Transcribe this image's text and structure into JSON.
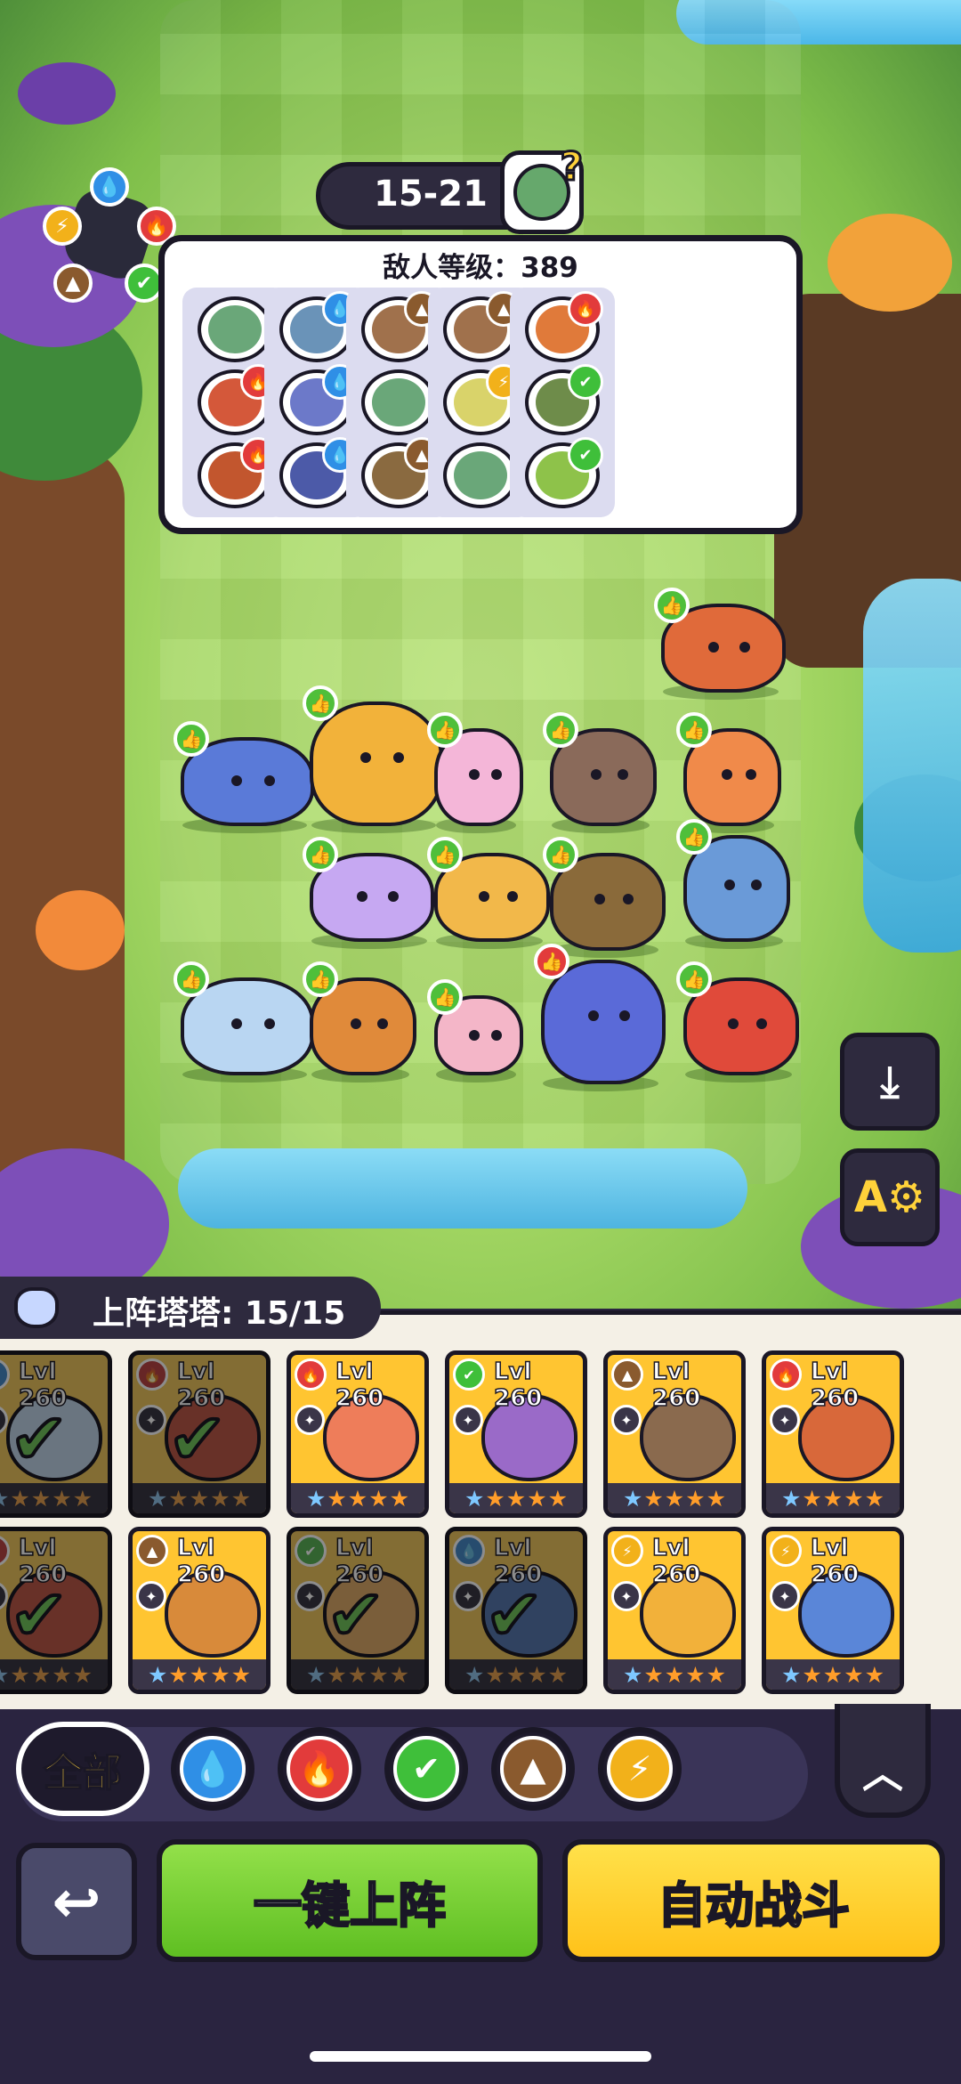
{
  "stage": {
    "label": "15-21"
  },
  "enemy_panel": {
    "title": "敌人等级：389",
    "waves": [
      {
        "enemies": [
          {
            "face": "#6aa779",
            "element": "none"
          },
          {
            "face": "#d4583a",
            "element": "fire"
          },
          {
            "face": "#c2562e",
            "element": "fire"
          }
        ]
      },
      {
        "enemies": [
          {
            "face": "#6a93b8",
            "element": "water"
          },
          {
            "face": "#6c79c9",
            "element": "water"
          },
          {
            "face": "#4c5aa8",
            "element": "water"
          }
        ]
      },
      {
        "enemies": [
          {
            "face": "#a0714c",
            "element": "earth"
          },
          {
            "face": "#6aa779",
            "element": "none"
          },
          {
            "face": "#8a6a40",
            "element": "earth"
          }
        ]
      },
      {
        "enemies": [
          {
            "face": "#a0714c",
            "element": "earth"
          },
          {
            "face": "#d9d36a",
            "element": "lightning"
          },
          {
            "face": "#6aa779",
            "element": "none"
          }
        ]
      },
      {
        "enemies": [
          {
            "face": "#e07a3a",
            "element": "fire"
          },
          {
            "face": "#6e8c4a",
            "element": "nature"
          },
          {
            "face": "#8ec24a",
            "element": "nature"
          }
        ]
      }
    ]
  },
  "roster": {
    "label": "上阵塔塔: 15/15",
    "cards": [
      {
        "level": "Lvl 260",
        "element": "water",
        "art": "#b9d6f2",
        "deployed": true,
        "cut": true
      },
      {
        "level": "Lvl 260",
        "element": "fire",
        "art": "#e0503a",
        "deployed": true
      },
      {
        "level": "Lvl 260",
        "element": "fire",
        "art": "#ee7d5a",
        "deployed": false
      },
      {
        "level": "Lvl 260",
        "element": "nature",
        "art": "#9a6ac8",
        "deployed": false
      },
      {
        "level": "Lvl 260",
        "element": "earth",
        "art": "#8a6a4e",
        "deployed": false
      },
      {
        "level": "Lvl 260",
        "element": "fire",
        "art": "#d8683a",
        "deployed": false
      },
      {
        "level": "Lvl 260",
        "element": "fire",
        "art": "#e0503a",
        "deployed": true,
        "cut": true
      },
      {
        "level": "Lvl 260",
        "element": "earth",
        "art": "#d88a3a",
        "deployed": false
      },
      {
        "level": "Lvl 260",
        "element": "nature",
        "art": "#f2a84a",
        "deployed": true
      },
      {
        "level": "Lvl 260",
        "element": "water",
        "art": "#4a7ac8",
        "deployed": true
      },
      {
        "level": "Lvl 260",
        "element": "lightning",
        "art": "#f2b13a",
        "deployed": false
      },
      {
        "level": "Lvl 260",
        "element": "lightning",
        "art": "#5a86d8",
        "deployed": false
      }
    ]
  },
  "filters": {
    "all_label": "全部",
    "elements": [
      "water",
      "fire",
      "nature",
      "earth",
      "lightning"
    ],
    "collapse_icon": "chevron-up-icon"
  },
  "actions": {
    "back_icon": "return-arrow-icon",
    "one_click_label": "一键上阵",
    "auto_battle_label": "自动战斗"
  },
  "colors": {
    "water": "#2f8fe6",
    "fire": "#e23b3b",
    "nature": "#3fbf3a",
    "earth": "#8a5a2e",
    "lightning": "#f2b11a",
    "none": "#7a7a7a",
    "card": "#ffc531",
    "green_button": "#6cc92a",
    "yellow_button": "#ffd21a"
  },
  "icons": {
    "water": "💧",
    "fire": "🔥",
    "nature": "✔",
    "earth": "▲",
    "lightning": "⚡",
    "none": "●"
  }
}
